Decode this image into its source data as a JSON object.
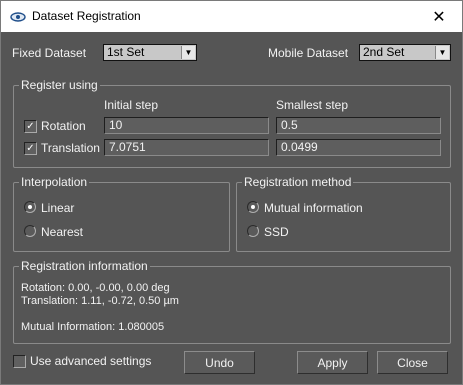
{
  "window": {
    "title": "Dataset Registration",
    "close_glyph": "✕"
  },
  "datasets": {
    "fixed_label": "Fixed Dataset",
    "fixed_value": "1st Set",
    "mobile_label": "Mobile Dataset",
    "mobile_value": "2nd Set"
  },
  "register_using": {
    "title": "Register using",
    "initial_step_header": "Initial step",
    "smallest_step_header": "Smallest step",
    "rotation": {
      "label": "Rotation",
      "checked": true,
      "initial": "10",
      "smallest": "0.5"
    },
    "translation": {
      "label": "Translation",
      "checked": true,
      "initial": "7.0751",
      "smallest": "0.0499"
    }
  },
  "interpolation": {
    "title": "Interpolation",
    "options": [
      {
        "label": "Linear",
        "selected": true
      },
      {
        "label": "Nearest",
        "selected": false
      }
    ]
  },
  "registration_method": {
    "title": "Registration method",
    "options": [
      {
        "label": "Mutual information",
        "selected": true
      },
      {
        "label": "SSD",
        "selected": false
      }
    ]
  },
  "registration_information": {
    "title": "Registration information",
    "rotation_line": "Rotation: 0.00, -0.00, 0.00 deg",
    "translation_line": "Translation: 1.11, -0.72, 0.50 µm",
    "mutual_information_line": "Mutual Information: 1.080005"
  },
  "footer": {
    "advanced_label": "Use advanced settings",
    "advanced_checked": false,
    "undo_label": "Undo",
    "apply_label": "Apply",
    "close_label": "Close"
  },
  "icons": {
    "app": "eye-icon",
    "checkmark": "✓",
    "dropdown": "▼"
  },
  "colors": {
    "background": "#555555",
    "titlebar": "#ffffff",
    "text": "#f2f2f2"
  }
}
